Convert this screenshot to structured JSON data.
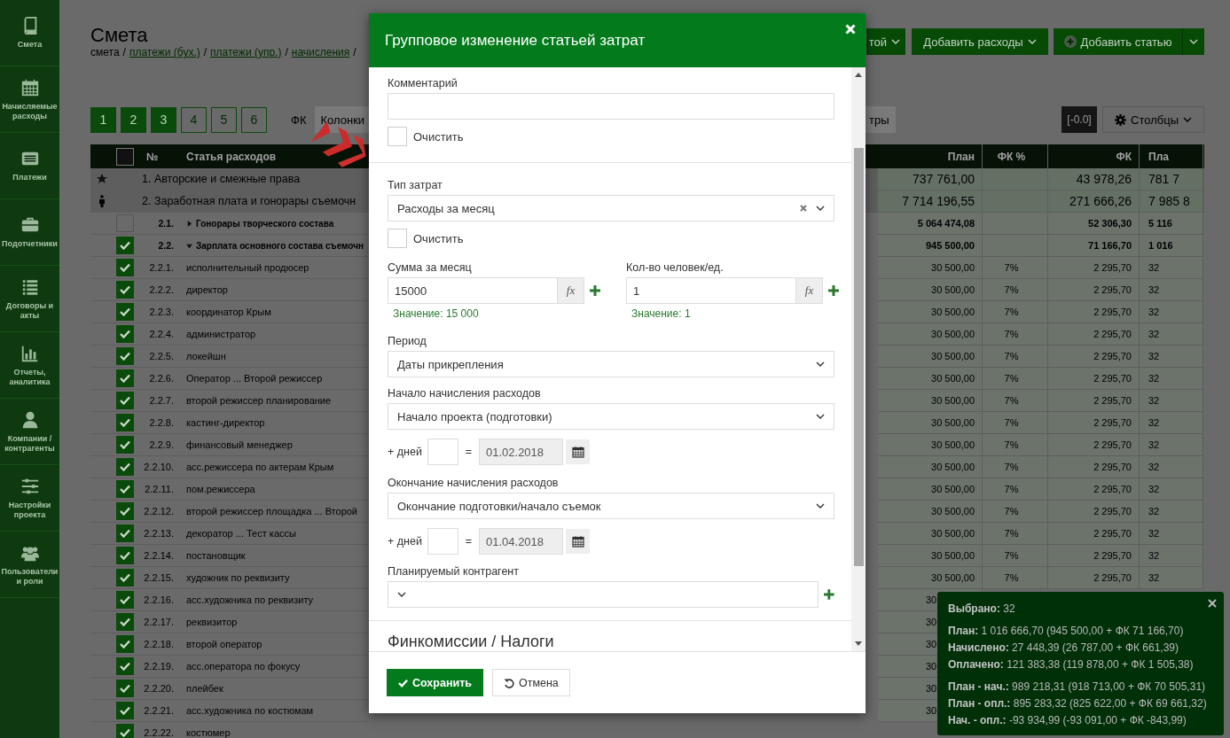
{
  "sidebar": {
    "items": [
      {
        "label": "Смета"
      },
      {
        "label": "Начисляемые расходы"
      },
      {
        "label": "Платежи"
      },
      {
        "label": "Подотчетники"
      },
      {
        "label": "Договоры и акты"
      },
      {
        "label": "Отчеты, аналитика"
      },
      {
        "label": "Компании / контрагенты"
      },
      {
        "label": "Настройки проекта"
      },
      {
        "label": "Пользователи и роли"
      }
    ]
  },
  "page": {
    "title": "Смета",
    "breadcrumb": [
      {
        "label": "смета",
        "link": false
      },
      {
        "label": "/",
        "link": false
      },
      {
        "label": "платежи (бух.)",
        "link": true
      },
      {
        "label": "/",
        "link": false
      },
      {
        "label": "платежи (упр.)",
        "link": true
      },
      {
        "label": "/",
        "link": false
      },
      {
        "label": "начисления",
        "link": true
      },
      {
        "label": "/",
        "link": false
      }
    ]
  },
  "actions": [
    {
      "label": "той",
      "kind": "dropdown"
    },
    {
      "label": "Добавить расходы",
      "kind": "dropdown"
    },
    {
      "label": "Добавить статью",
      "kind": "split"
    }
  ],
  "pages": [
    {
      "label": "1",
      "selected": true
    },
    {
      "label": "2",
      "selected": true
    },
    {
      "label": "3",
      "selected": true
    },
    {
      "label": "4",
      "selected": false
    },
    {
      "label": "5",
      "selected": false
    },
    {
      "label": "6",
      "selected": false
    }
  ],
  "filter": {
    "label": "ФК",
    "select": "Колонки"
  },
  "tools": {
    "filters_button": "тры",
    "range_badge": "[-0.0]",
    "columns_button": "Столбцы"
  },
  "table": {
    "header_checked": false,
    "columns_left": [
      "№",
      "Статья расходов"
    ],
    "columns_right": [
      "План",
      "ФК %",
      "ФК",
      "Пла"
    ],
    "rows": [
      {
        "kind": "group",
        "label": "1. Авторские и смежные права",
        "plan": "737 761,00",
        "fk": "43 978,26",
        "plan2": "781 7"
      },
      {
        "kind": "group",
        "label": "2. Заработная плата и гонорары съемочн",
        "plan": "7 714 196,55",
        "fk": "271 666,26",
        "plan2": "7 985 8"
      },
      {
        "kind": "subgroup",
        "number": "2.1.",
        "label": "Гонорары творческого состава",
        "checked": false,
        "expanded": false,
        "plan": "5 064 474,08",
        "fk": "52 306,30",
        "plan2": "5 116"
      },
      {
        "kind": "subgroup",
        "number": "2.2.",
        "label": "Зарплата основного состава съемочн",
        "checked": true,
        "expanded": true,
        "plan": "945 500,00",
        "fk": "71 166,70",
        "plan2": "1 016"
      },
      {
        "kind": "item",
        "number": "2.2.1.",
        "label": "исполнительный продюсер",
        "checked": true,
        "plan": "30 500,00",
        "fk_pct": "7%",
        "fk": "2 295,70",
        "plan2": "32"
      },
      {
        "kind": "item",
        "number": "2.2.2.",
        "label": "директор",
        "checked": true,
        "plan": "30 500,00",
        "fk_pct": "7%",
        "fk": "2 295,70",
        "plan2": "32"
      },
      {
        "kind": "item",
        "number": "2.2.3.",
        "label": "координатор Крым",
        "checked": true,
        "plan": "30 500,00",
        "fk_pct": "7%",
        "fk": "2 295,70",
        "plan2": "32"
      },
      {
        "kind": "item",
        "number": "2.2.4.",
        "label": "администратор",
        "checked": true,
        "plan": "30 500,00",
        "fk_pct": "7%",
        "fk": "2 295,70",
        "plan2": "32"
      },
      {
        "kind": "item",
        "number": "2.2.5.",
        "label": "локейшн",
        "checked": true,
        "plan": "30 500,00",
        "fk_pct": "7%",
        "fk": "2 295,70",
        "plan2": "32"
      },
      {
        "kind": "item",
        "number": "2.2.6.",
        "label": "Оператор ... Второй режиссер",
        "checked": true,
        "plan": "30 500,00",
        "fk_pct": "7%",
        "fk": "2 295,70",
        "plan2": "32"
      },
      {
        "kind": "item",
        "number": "2.2.7.",
        "label": "второй режиссер планирование",
        "checked": true,
        "plan": "30 500,00",
        "fk_pct": "7%",
        "fk": "2 295,70",
        "plan2": "32"
      },
      {
        "kind": "item",
        "number": "2.2.8.",
        "label": "кастинг-директор",
        "checked": true,
        "plan": "30 500,00",
        "fk_pct": "7%",
        "fk": "2 295,70",
        "plan2": "32"
      },
      {
        "kind": "item",
        "number": "2.2.9.",
        "label": "финансовый менеджер",
        "checked": true,
        "plan": "30 500,00",
        "fk_pct": "7%",
        "fk": "2 295,70",
        "plan2": "32"
      },
      {
        "kind": "item",
        "number": "2.2.10.",
        "label": "асс.режиссера по актерам Крым",
        "checked": true,
        "plan": "30 500,00",
        "fk_pct": "7%",
        "fk": "2 295,70",
        "plan2": "32"
      },
      {
        "kind": "item",
        "number": "2.2.11.",
        "label": "пом.режиссера",
        "checked": true,
        "plan": "30 500,00",
        "fk_pct": "7%",
        "fk": "2 295,70",
        "plan2": "32"
      },
      {
        "kind": "item",
        "number": "2.2.12.",
        "label": "второй режиссер площадка ... Второй",
        "checked": true,
        "plan": "30 500,00",
        "fk_pct": "7%",
        "fk": "2 295,70",
        "plan2": "32"
      },
      {
        "kind": "item",
        "number": "2.2.13.",
        "label": "декоратор ... Тест кассы",
        "checked": true,
        "plan": "30 500,00",
        "fk_pct": "7%",
        "fk": "2 295,70",
        "plan2": "32"
      },
      {
        "kind": "item",
        "number": "2.2.14.",
        "label": "постановщик",
        "checked": true,
        "plan": "30 500,00",
        "fk_pct": "7%",
        "fk": "2 295,70",
        "plan2": "32"
      },
      {
        "kind": "item",
        "number": "2.2.15.",
        "label": "художник по реквизиту",
        "checked": true,
        "plan": "30 500,00",
        "fk_pct": "7%",
        "fk": "2 295,70",
        "plan2": "32"
      },
      {
        "kind": "item",
        "number": "2.2.16.",
        "label": "асс.художника по реквизиту",
        "checked": true,
        "plan": "30"
      },
      {
        "kind": "item",
        "number": "2.2.17.",
        "label": "реквизитор",
        "checked": true,
        "plan": "30"
      },
      {
        "kind": "item",
        "number": "2.2.18.",
        "label": "второй оператор",
        "checked": true,
        "plan": "30"
      },
      {
        "kind": "item",
        "number": "2.2.19.",
        "label": "асс.оператора по фокусу",
        "checked": true,
        "plan": "30"
      },
      {
        "kind": "item",
        "number": "2.2.20.",
        "label": "плейбек",
        "checked": true,
        "plan": "30"
      },
      {
        "kind": "item",
        "number": "2.2.21.",
        "label": "асс.художника по костюмам",
        "checked": true,
        "plan": "30"
      },
      {
        "kind": "item",
        "number": "2.2.22.",
        "label": "костюмер",
        "checked": true
      }
    ]
  },
  "summary": {
    "groups": [
      [
        "**Выбрано:** 32"
      ],
      [
        "**План:** 1 016 666,70 (945 500,00 + ФК 71 166,70)",
        "**Начислено:** 27 448,39 (26 787,00 + ФК 661,39)",
        "**Оплачено:** 121 383,38 (119 878,00 + ФК 1 505,38)"
      ],
      [
        "**План - нач.:** 989 218,31 (918 713,00 + ФК 70 505,31)",
        "**План - опл.:** 895 283,32 (825 622,00 + ФК 69 661,32)",
        "**Нач. - опл.:** -93 934,99 (-93 091,00 + ФК -843,99)"
      ]
    ]
  },
  "dialog": {
    "title": "Групповое изменение статьей затрат",
    "comment": {
      "label": "Комментарий",
      "clear": {
        "label": "Очистить",
        "checked": false
      }
    },
    "cost_type": {
      "label": "Тип затрат",
      "value": "Расходы за месяц",
      "clear": {
        "label": "Очистить",
        "checked": false
      }
    },
    "amount": {
      "label": "Сумма за месяц",
      "value": "15000",
      "fx": "fx",
      "hint": "Значение: 15 000"
    },
    "count": {
      "label": "Кол-во человек/ед.",
      "value": "1",
      "fx": "fx",
      "hint": "Значение: 1"
    },
    "period": {
      "label": "Период",
      "value": "Даты прикрепления"
    },
    "start": {
      "label": "Начало начисления расходов",
      "value": "Начало проекта (подготовки)",
      "days_label": "+ дней",
      "equals": "=",
      "date": "01.02.2018"
    },
    "end": {
      "label": "Окончание начисления расходов",
      "value": "Окончание подготовки/начало съемок",
      "days_label": "+ дней",
      "equals": "=",
      "date": "01.04.2018"
    },
    "counterparty": {
      "label": "Планируемый контрагент"
    },
    "section_heading": "Финкомиссии / Налоги",
    "buttons": [
      {
        "label": "Сохранить",
        "kind": "primary"
      },
      {
        "label": "Отмена",
        "kind": "cancel"
      }
    ]
  }
}
